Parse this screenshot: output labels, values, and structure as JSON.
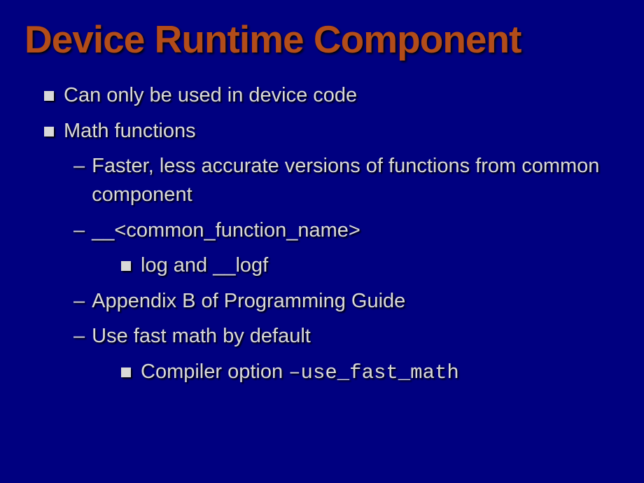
{
  "title": "Device Runtime Component",
  "items": {
    "b1": "Can only be used in device code",
    "b2": "Math functions",
    "b2a": "Faster, less accurate versions of functions from common component",
    "b2b": "__<common_function_name>",
    "b2b1": "log and __logf",
    "b2c": "Appendix B of Programming Guide",
    "b2d": "Use fast math by default",
    "b2d1_text": "Compiler option ",
    "b2d1_code": "–use_fast_math"
  }
}
